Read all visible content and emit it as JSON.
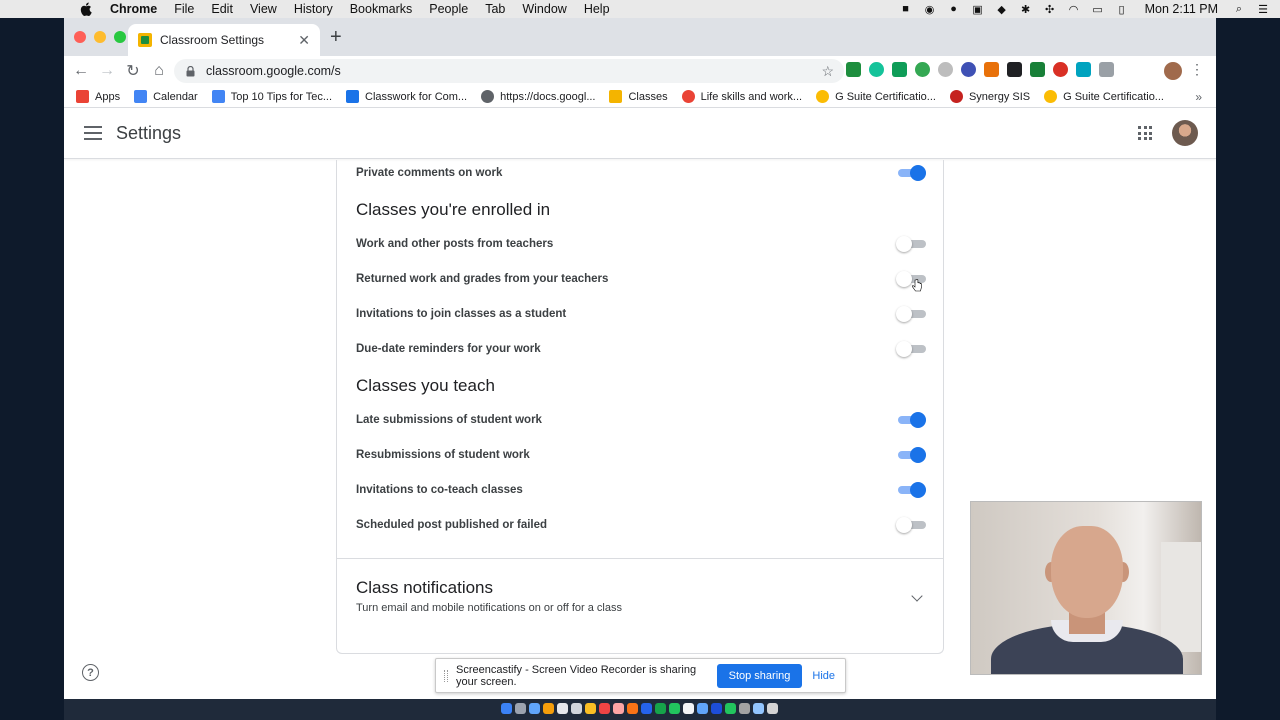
{
  "menubar": {
    "app": "Chrome",
    "items": [
      "File",
      "Edit",
      "View",
      "History",
      "Bookmarks",
      "People",
      "Tab",
      "Window",
      "Help"
    ],
    "clock": "Mon 2:11 PM"
  },
  "browser": {
    "tab_title": "Classroom Settings",
    "url": "classroom.google.com/s",
    "bookmarks": [
      {
        "label": "Apps",
        "color": "#ea4335"
      },
      {
        "label": "Calendar",
        "color": "#4285f4"
      },
      {
        "label": "Top 10 Tips for Tec...",
        "color": "#4285f4"
      },
      {
        "label": "Classwork for Com...",
        "color": "#1a73e8"
      },
      {
        "label": "https://docs.googl...",
        "color": "#5f6368"
      },
      {
        "label": "Classes",
        "color": "#f4b400"
      },
      {
        "label": "Life skills and work...",
        "color": "#ea4335"
      },
      {
        "label": "G Suite Certificatio...",
        "color": "#fbbc04"
      },
      {
        "label": "Synergy SIS",
        "color": "#c5221f"
      },
      {
        "label": "G Suite Certificatio...",
        "color": "#fbbc04"
      }
    ]
  },
  "app": {
    "title": "Settings"
  },
  "settings": {
    "top_row": {
      "label": "Private comments on work",
      "on": true
    },
    "enrolled": {
      "title": "Classes you're enrolled in",
      "rows": [
        {
          "label": "Work and other posts from teachers",
          "on": false
        },
        {
          "label": "Returned work and grades from your teachers",
          "on": false
        },
        {
          "label": "Invitations to join classes as a student",
          "on": false
        },
        {
          "label": "Due-date reminders for your work",
          "on": false
        }
      ]
    },
    "teach": {
      "title": "Classes you teach",
      "rows": [
        {
          "label": "Late submissions of student work",
          "on": true
        },
        {
          "label": "Resubmissions of student work",
          "on": true
        },
        {
          "label": "Invitations to co-teach classes",
          "on": true
        },
        {
          "label": "Scheduled post published or failed",
          "on": false
        }
      ]
    },
    "class_notifications": {
      "title": "Class notifications",
      "subtitle": "Turn email and mobile notifications on or off for a class"
    }
  },
  "sharebar": {
    "message": "Screencastify - Screen Video Recorder is sharing your screen.",
    "stop_label": "Stop sharing",
    "hide_label": "Hide"
  },
  "colors": {
    "accent": "#1a73e8",
    "toggle_on_track": "#8ab4f8",
    "toggle_off_track": "#bdc1c6"
  }
}
